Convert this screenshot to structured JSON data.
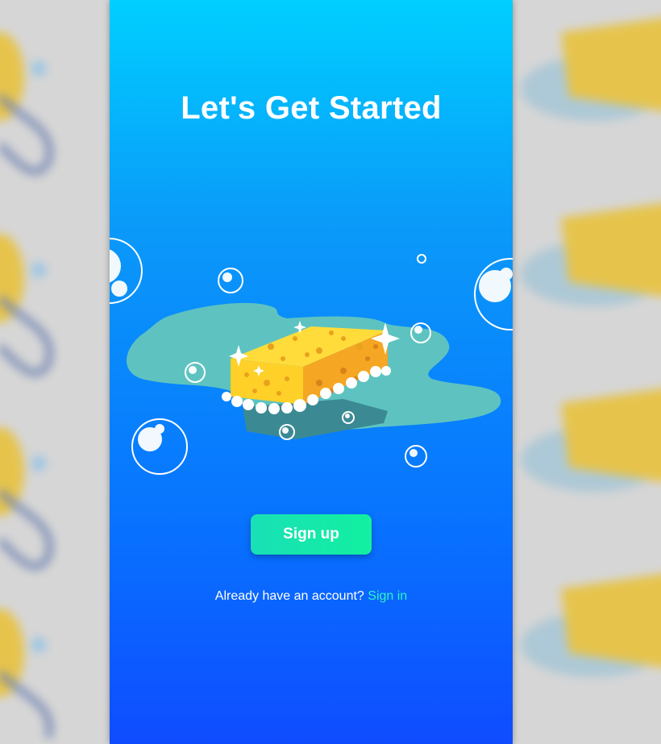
{
  "page": {
    "title": "Let's Get Started"
  },
  "illustration": {
    "name": "sponge-with-bubbles"
  },
  "actions": {
    "signup_label": "Sign up",
    "signin_prompt": "Already have an account?",
    "signin_label": "Sign in"
  },
  "colors": {
    "gradient_top": "#00cfff",
    "gradient_bottom": "#0f4cff",
    "button_start": "#19e0b6",
    "button_end": "#12f0a0",
    "link": "#2bf5c8",
    "sponge_yellow": "#ffd83a",
    "sponge_orange": "#f5a623",
    "puddle": "#5ec3c0"
  }
}
